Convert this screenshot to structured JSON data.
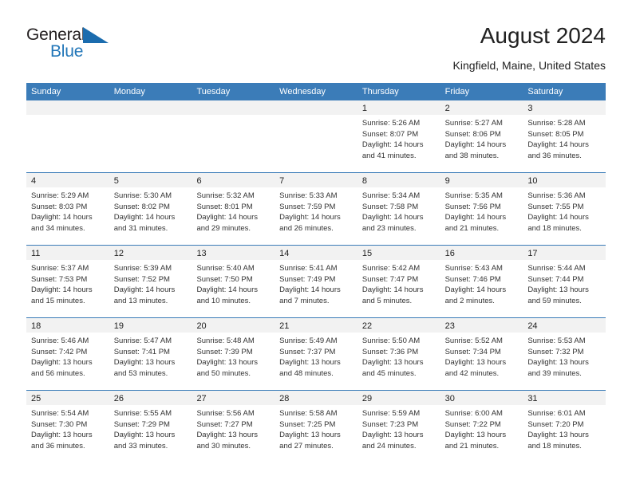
{
  "brand": {
    "word1": "General",
    "word2": "Blue",
    "accent_color": "#2176b8",
    "triangle_icon": "brand-triangle-icon"
  },
  "header": {
    "title": "August 2024",
    "subtitle": "Kingfield, Maine, United States"
  },
  "calendar": {
    "header_bg": "#3b7cb8",
    "weekday_headers": [
      "Sunday",
      "Monday",
      "Tuesday",
      "Wednesday",
      "Thursday",
      "Friday",
      "Saturday"
    ],
    "weeks": [
      [
        {
          "day": "",
          "empty": true
        },
        {
          "day": "",
          "empty": true
        },
        {
          "day": "",
          "empty": true
        },
        {
          "day": "",
          "empty": true
        },
        {
          "day": "1",
          "sunrise": "Sunrise: 5:26 AM",
          "sunset": "Sunset: 8:07 PM",
          "daylight_line1": "Daylight: 14 hours",
          "daylight_line2": "and 41 minutes."
        },
        {
          "day": "2",
          "sunrise": "Sunrise: 5:27 AM",
          "sunset": "Sunset: 8:06 PM",
          "daylight_line1": "Daylight: 14 hours",
          "daylight_line2": "and 38 minutes."
        },
        {
          "day": "3",
          "sunrise": "Sunrise: 5:28 AM",
          "sunset": "Sunset: 8:05 PM",
          "daylight_line1": "Daylight: 14 hours",
          "daylight_line2": "and 36 minutes."
        }
      ],
      [
        {
          "day": "4",
          "sunrise": "Sunrise: 5:29 AM",
          "sunset": "Sunset: 8:03 PM",
          "daylight_line1": "Daylight: 14 hours",
          "daylight_line2": "and 34 minutes."
        },
        {
          "day": "5",
          "sunrise": "Sunrise: 5:30 AM",
          "sunset": "Sunset: 8:02 PM",
          "daylight_line1": "Daylight: 14 hours",
          "daylight_line2": "and 31 minutes."
        },
        {
          "day": "6",
          "sunrise": "Sunrise: 5:32 AM",
          "sunset": "Sunset: 8:01 PM",
          "daylight_line1": "Daylight: 14 hours",
          "daylight_line2": "and 29 minutes."
        },
        {
          "day": "7",
          "sunrise": "Sunrise: 5:33 AM",
          "sunset": "Sunset: 7:59 PM",
          "daylight_line1": "Daylight: 14 hours",
          "daylight_line2": "and 26 minutes."
        },
        {
          "day": "8",
          "sunrise": "Sunrise: 5:34 AM",
          "sunset": "Sunset: 7:58 PM",
          "daylight_line1": "Daylight: 14 hours",
          "daylight_line2": "and 23 minutes."
        },
        {
          "day": "9",
          "sunrise": "Sunrise: 5:35 AM",
          "sunset": "Sunset: 7:56 PM",
          "daylight_line1": "Daylight: 14 hours",
          "daylight_line2": "and 21 minutes."
        },
        {
          "day": "10",
          "sunrise": "Sunrise: 5:36 AM",
          "sunset": "Sunset: 7:55 PM",
          "daylight_line1": "Daylight: 14 hours",
          "daylight_line2": "and 18 minutes."
        }
      ],
      [
        {
          "day": "11",
          "sunrise": "Sunrise: 5:37 AM",
          "sunset": "Sunset: 7:53 PM",
          "daylight_line1": "Daylight: 14 hours",
          "daylight_line2": "and 15 minutes."
        },
        {
          "day": "12",
          "sunrise": "Sunrise: 5:39 AM",
          "sunset": "Sunset: 7:52 PM",
          "daylight_line1": "Daylight: 14 hours",
          "daylight_line2": "and 13 minutes."
        },
        {
          "day": "13",
          "sunrise": "Sunrise: 5:40 AM",
          "sunset": "Sunset: 7:50 PM",
          "daylight_line1": "Daylight: 14 hours",
          "daylight_line2": "and 10 minutes."
        },
        {
          "day": "14",
          "sunrise": "Sunrise: 5:41 AM",
          "sunset": "Sunset: 7:49 PM",
          "daylight_line1": "Daylight: 14 hours",
          "daylight_line2": "and 7 minutes."
        },
        {
          "day": "15",
          "sunrise": "Sunrise: 5:42 AM",
          "sunset": "Sunset: 7:47 PM",
          "daylight_line1": "Daylight: 14 hours",
          "daylight_line2": "and 5 minutes."
        },
        {
          "day": "16",
          "sunrise": "Sunrise: 5:43 AM",
          "sunset": "Sunset: 7:46 PM",
          "daylight_line1": "Daylight: 14 hours",
          "daylight_line2": "and 2 minutes."
        },
        {
          "day": "17",
          "sunrise": "Sunrise: 5:44 AM",
          "sunset": "Sunset: 7:44 PM",
          "daylight_line1": "Daylight: 13 hours",
          "daylight_line2": "and 59 minutes."
        }
      ],
      [
        {
          "day": "18",
          "sunrise": "Sunrise: 5:46 AM",
          "sunset": "Sunset: 7:42 PM",
          "daylight_line1": "Daylight: 13 hours",
          "daylight_line2": "and 56 minutes."
        },
        {
          "day": "19",
          "sunrise": "Sunrise: 5:47 AM",
          "sunset": "Sunset: 7:41 PM",
          "daylight_line1": "Daylight: 13 hours",
          "daylight_line2": "and 53 minutes."
        },
        {
          "day": "20",
          "sunrise": "Sunrise: 5:48 AM",
          "sunset": "Sunset: 7:39 PM",
          "daylight_line1": "Daylight: 13 hours",
          "daylight_line2": "and 50 minutes."
        },
        {
          "day": "21",
          "sunrise": "Sunrise: 5:49 AM",
          "sunset": "Sunset: 7:37 PM",
          "daylight_line1": "Daylight: 13 hours",
          "daylight_line2": "and 48 minutes."
        },
        {
          "day": "22",
          "sunrise": "Sunrise: 5:50 AM",
          "sunset": "Sunset: 7:36 PM",
          "daylight_line1": "Daylight: 13 hours",
          "daylight_line2": "and 45 minutes."
        },
        {
          "day": "23",
          "sunrise": "Sunrise: 5:52 AM",
          "sunset": "Sunset: 7:34 PM",
          "daylight_line1": "Daylight: 13 hours",
          "daylight_line2": "and 42 minutes."
        },
        {
          "day": "24",
          "sunrise": "Sunrise: 5:53 AM",
          "sunset": "Sunset: 7:32 PM",
          "daylight_line1": "Daylight: 13 hours",
          "daylight_line2": "and 39 minutes."
        }
      ],
      [
        {
          "day": "25",
          "sunrise": "Sunrise: 5:54 AM",
          "sunset": "Sunset: 7:30 PM",
          "daylight_line1": "Daylight: 13 hours",
          "daylight_line2": "and 36 minutes."
        },
        {
          "day": "26",
          "sunrise": "Sunrise: 5:55 AM",
          "sunset": "Sunset: 7:29 PM",
          "daylight_line1": "Daylight: 13 hours",
          "daylight_line2": "and 33 minutes."
        },
        {
          "day": "27",
          "sunrise": "Sunrise: 5:56 AM",
          "sunset": "Sunset: 7:27 PM",
          "daylight_line1": "Daylight: 13 hours",
          "daylight_line2": "and 30 minutes."
        },
        {
          "day": "28",
          "sunrise": "Sunrise: 5:58 AM",
          "sunset": "Sunset: 7:25 PM",
          "daylight_line1": "Daylight: 13 hours",
          "daylight_line2": "and 27 minutes."
        },
        {
          "day": "29",
          "sunrise": "Sunrise: 5:59 AM",
          "sunset": "Sunset: 7:23 PM",
          "daylight_line1": "Daylight: 13 hours",
          "daylight_line2": "and 24 minutes."
        },
        {
          "day": "30",
          "sunrise": "Sunrise: 6:00 AM",
          "sunset": "Sunset: 7:22 PM",
          "daylight_line1": "Daylight: 13 hours",
          "daylight_line2": "and 21 minutes."
        },
        {
          "day": "31",
          "sunrise": "Sunrise: 6:01 AM",
          "sunset": "Sunset: 7:20 PM",
          "daylight_line1": "Daylight: 13 hours",
          "daylight_line2": "and 18 minutes."
        }
      ]
    ]
  }
}
